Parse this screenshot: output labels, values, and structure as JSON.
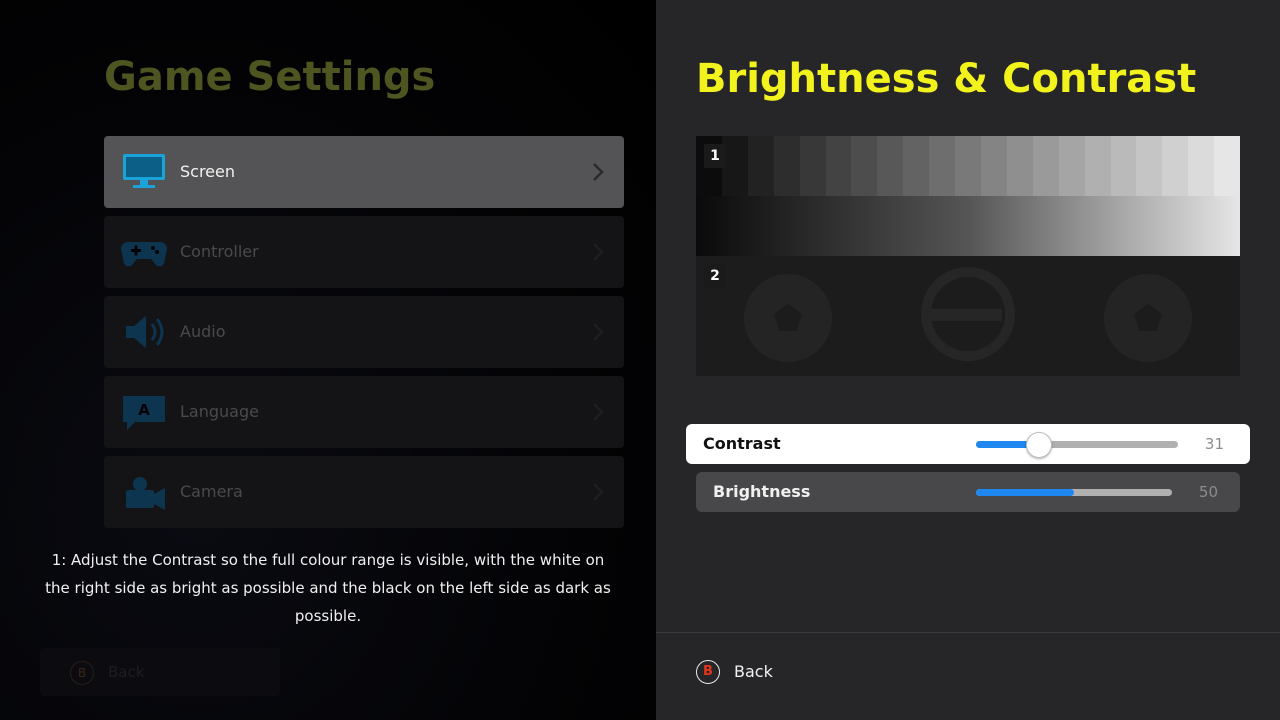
{
  "left_panel": {
    "title": "Game Settings",
    "menu": [
      {
        "label": "Screen",
        "icon": "monitor-icon",
        "active": true
      },
      {
        "label": "Controller",
        "icon": "gamepad-icon",
        "active": false
      },
      {
        "label": "Audio",
        "icon": "speaker-icon",
        "active": false
      },
      {
        "label": "Language",
        "icon": "speech-bubble-a-icon",
        "active": false
      },
      {
        "label": "Camera",
        "icon": "video-camera-icon",
        "active": false
      }
    ],
    "hint": "1: Adjust the Contrast so the full colour range is visible, with the white on the right side as bright as possible and the black on the left side as dark as possible.",
    "back": {
      "button_glyph": "B",
      "label": "Back"
    }
  },
  "right_panel": {
    "title": "Brightness & Contrast",
    "test_labels": [
      "1",
      "2"
    ],
    "sliders": [
      {
        "label": "Contrast",
        "value": "31",
        "fraction": 0.31,
        "selected": true
      },
      {
        "label": "Brightness",
        "value": "50",
        "fraction": 0.5,
        "selected": false
      }
    ],
    "back": {
      "button_glyph": "B",
      "label": "Back"
    }
  },
  "colors": {
    "title_yellow": "#f2f21c",
    "slider_fill": "#1e88f0",
    "back_button_red": "#e8361c"
  }
}
